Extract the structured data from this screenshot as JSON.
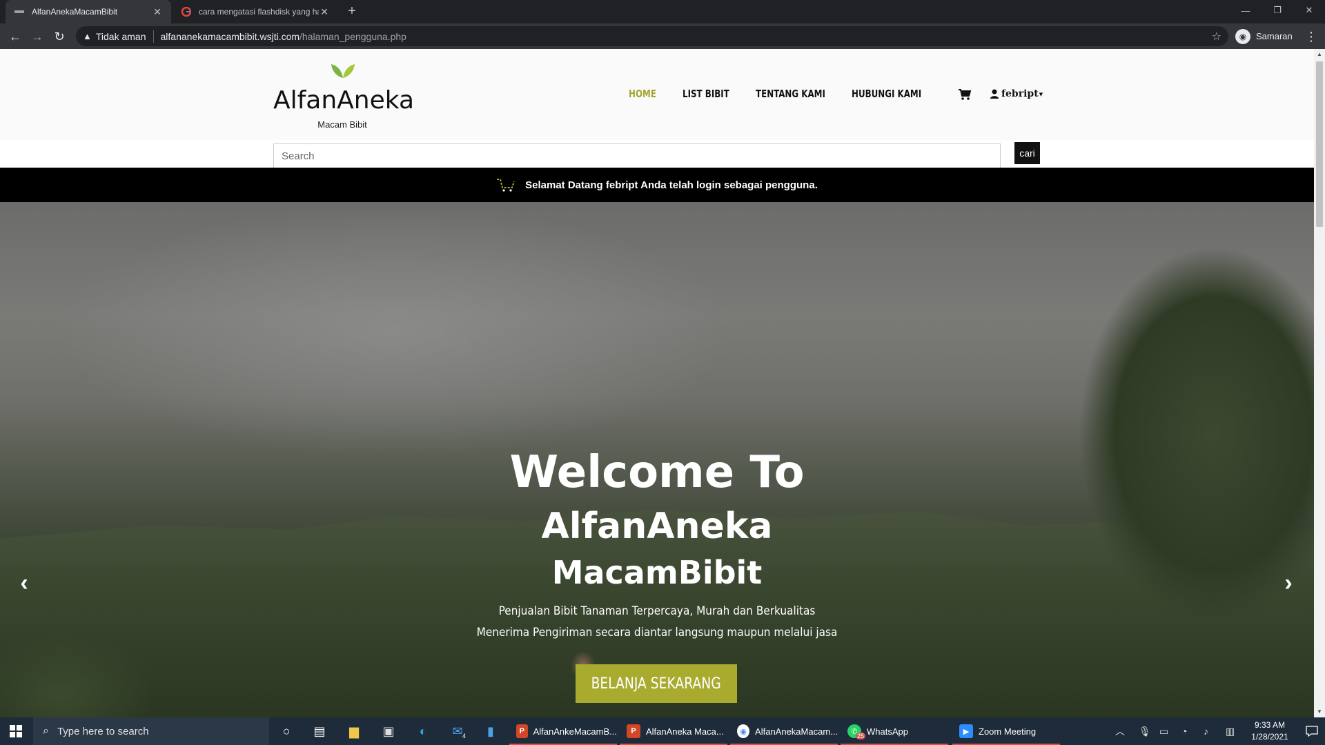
{
  "browser": {
    "tabs": [
      {
        "title": "AlfanAnekaMacamBibit",
        "active": true
      },
      {
        "title": "cara mengatasi flashdisk yang ha",
        "active": false
      }
    ],
    "new_tab": "+",
    "window_controls": {
      "minimize": "—",
      "restore": "❐",
      "close": "✕"
    },
    "back": "←",
    "forward": "→",
    "reload": "↻",
    "security_label": "Tidak aman",
    "url_host": "alfananekamacambibit.wsjti.com",
    "url_path": "/halaman_pengguna.php",
    "profile_name": "Samaran",
    "menu": "⋮"
  },
  "site": {
    "brand": "AlfanAneka",
    "tagline": "Macam Bibit",
    "nav": [
      {
        "label": "HOME",
        "active": true
      },
      {
        "label": "LIST BIBIT",
        "active": false
      },
      {
        "label": "TENTANG KAMI",
        "active": false
      },
      {
        "label": "HUBUNGI KAMI",
        "active": false
      }
    ],
    "user": "febript",
    "search_placeholder": "Search",
    "search_button": "cari",
    "welcome": {
      "prefix": "Selamat Datang ",
      "username": "febript",
      "middle": " Anda telah login sebagai ",
      "role": "pengguna",
      "suffix": "."
    },
    "hero": {
      "line1": "Welcome To",
      "line2": "AlfanAneka",
      "line3": "MacamBibit",
      "sub1": "Penjualan Bibit Tanaman Terpercaya, Murah dan Berkualitas",
      "sub2": "Menerima Pengiriman secara diantar langsung maupun melalui jasa",
      "cta": "BELANJA SEKARANG",
      "prev": "‹",
      "next": "›"
    },
    "colors": {
      "accent": "#a3a430",
      "cta": "#a9ab2f",
      "leaf": "#8bc34a"
    }
  },
  "taskbar": {
    "search_placeholder": "Type here to search",
    "apps": [
      {
        "label": "AlfanAnkeMacamB...",
        "icon": "powerpoint-icon"
      },
      {
        "label": "AlfanAneka Maca...",
        "icon": "powerpoint-icon"
      },
      {
        "label": "AlfanAnekaMacam...",
        "icon": "chrome-icon"
      },
      {
        "label": "WhatsApp",
        "icon": "whatsapp-icon",
        "badge": "25"
      },
      {
        "label": "Zoom Meeting",
        "icon": "zoom-icon"
      }
    ],
    "mail_badge": "4",
    "time": "9:33 AM",
    "date": "1/28/2021"
  }
}
